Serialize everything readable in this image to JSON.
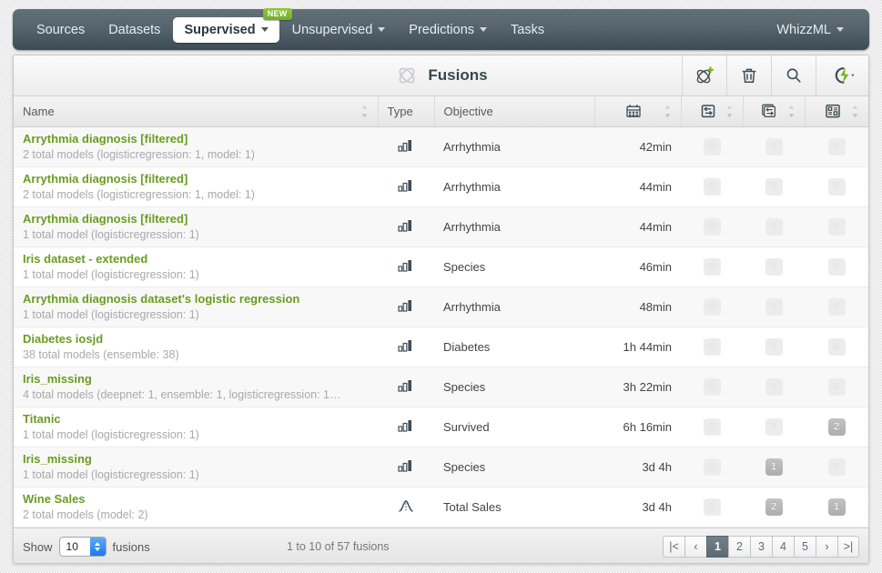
{
  "nav": {
    "items": [
      {
        "label": "Sources",
        "caret": false,
        "active": false,
        "badge": null
      },
      {
        "label": "Datasets",
        "caret": false,
        "active": false,
        "badge": null
      },
      {
        "label": "Supervised",
        "caret": true,
        "active": true,
        "badge": "NEW"
      },
      {
        "label": "Unsupervised",
        "caret": true,
        "active": false,
        "badge": null
      },
      {
        "label": "Predictions",
        "caret": true,
        "active": false,
        "badge": null
      },
      {
        "label": "Tasks",
        "caret": false,
        "active": false,
        "badge": null
      }
    ],
    "right": {
      "label": "WhizzML",
      "caret": true
    }
  },
  "header": {
    "title": "Fusions",
    "logo_icon": "fusion-logo-icon",
    "actions": [
      {
        "icon": "add-fusion-icon",
        "name": "create-fusion-button"
      },
      {
        "icon": "trash-icon",
        "name": "delete-button"
      },
      {
        "icon": "search-icon",
        "name": "search-button"
      },
      {
        "icon": "flash-icon",
        "name": "actions-menu-button"
      }
    ]
  },
  "table": {
    "columns": [
      {
        "label": "Name",
        "icon": null,
        "sortable": true
      },
      {
        "label": "Type",
        "icon": null,
        "sortable": false
      },
      {
        "label": "Objective",
        "icon": null,
        "sortable": false
      },
      {
        "label": "",
        "icon": "calendar-icon",
        "sortable": true
      },
      {
        "label": "",
        "icon": "single-prediction-icon",
        "sortable": true
      },
      {
        "label": "",
        "icon": "batch-prediction-icon",
        "sortable": true
      },
      {
        "label": "",
        "icon": "evaluation-icon",
        "sortable": true
      }
    ],
    "rows": [
      {
        "name": "Arrythmia diagnosis [filtered]",
        "sub": "2 total models (logisticregression: 1, model: 1)",
        "type_icon": "classification-icon",
        "objective": "Arrhythmia",
        "age": "42min",
        "predictions": "0",
        "batch_predictions": "0",
        "evaluations": "0"
      },
      {
        "name": "Arrythmia diagnosis [filtered]",
        "sub": "2 total models (logisticregression: 1, model: 1)",
        "type_icon": "classification-icon",
        "objective": "Arrhythmia",
        "age": "44min",
        "predictions": "0",
        "batch_predictions": "0",
        "evaluations": "0"
      },
      {
        "name": "Arrythmia diagnosis [filtered]",
        "sub": "1 total model (logisticregression: 1)",
        "type_icon": "classification-icon",
        "objective": "Arrhythmia",
        "age": "44min",
        "predictions": "0",
        "batch_predictions": "0",
        "evaluations": "0"
      },
      {
        "name": "Iris dataset - extended",
        "sub": "1 total model (logisticregression: 1)",
        "type_icon": "classification-icon",
        "objective": "Species",
        "age": "46min",
        "predictions": "0",
        "batch_predictions": "0",
        "evaluations": "0"
      },
      {
        "name": "Arrythmia diagnosis dataset's logistic regression",
        "sub": "1 total model (logisticregression: 1)",
        "type_icon": "classification-icon",
        "objective": "Arrhythmia",
        "age": "48min",
        "predictions": "0",
        "batch_predictions": "0",
        "evaluations": "0"
      },
      {
        "name": "Diabetes iosjd",
        "sub": "38 total models (ensemble: 38)",
        "type_icon": "classification-icon",
        "objective": "Diabetes",
        "age": "1h 44min",
        "predictions": "0",
        "batch_predictions": "0",
        "evaluations": "0"
      },
      {
        "name": "Iris_missing",
        "sub": "4 total models (deepnet: 1, ensemble: 1, logisticregression: 1…",
        "type_icon": "classification-icon",
        "objective": "Species",
        "age": "3h 22min",
        "predictions": "0",
        "batch_predictions": "0",
        "evaluations": "0"
      },
      {
        "name": "Titanic",
        "sub": "1 total model (logisticregression: 1)",
        "type_icon": "classification-icon",
        "objective": "Survived",
        "age": "6h 16min",
        "predictions": "0",
        "batch_predictions": "0",
        "evaluations": "2"
      },
      {
        "name": "Iris_missing",
        "sub": "1 total model (logisticregression: 1)",
        "type_icon": "classification-icon",
        "objective": "Species",
        "age": "3d 4h",
        "predictions": "0",
        "batch_predictions": "1",
        "evaluations": "0"
      },
      {
        "name": "Wine Sales",
        "sub": "2 total models (model: 2)",
        "type_icon": "regression-icon",
        "objective": "Total Sales",
        "age": "3d 4h",
        "predictions": "0",
        "batch_predictions": "2",
        "evaluations": "1"
      }
    ]
  },
  "footer": {
    "show_label": "Show",
    "page_size": "10",
    "unit_label": "fusions",
    "summary": "1 to 10 of 57 fusions",
    "pager": [
      {
        "label": "|<",
        "name": "first-page-button",
        "active": false
      },
      {
        "label": "‹",
        "name": "prev-page-button",
        "active": false
      },
      {
        "label": "1",
        "name": "page-1-button",
        "active": true
      },
      {
        "label": "2",
        "name": "page-2-button",
        "active": false
      },
      {
        "label": "3",
        "name": "page-3-button",
        "active": false
      },
      {
        "label": "4",
        "name": "page-4-button",
        "active": false
      },
      {
        "label": "5",
        "name": "page-5-button",
        "active": false
      },
      {
        "label": "›",
        "name": "next-page-button",
        "active": false
      },
      {
        "label": ">|",
        "name": "last-page-button",
        "active": false
      }
    ]
  },
  "colors": {
    "nav_bg": "#55646d",
    "accent_green": "#6a9d1f",
    "badge_green": "#8fc63d",
    "title": "#37474f"
  }
}
